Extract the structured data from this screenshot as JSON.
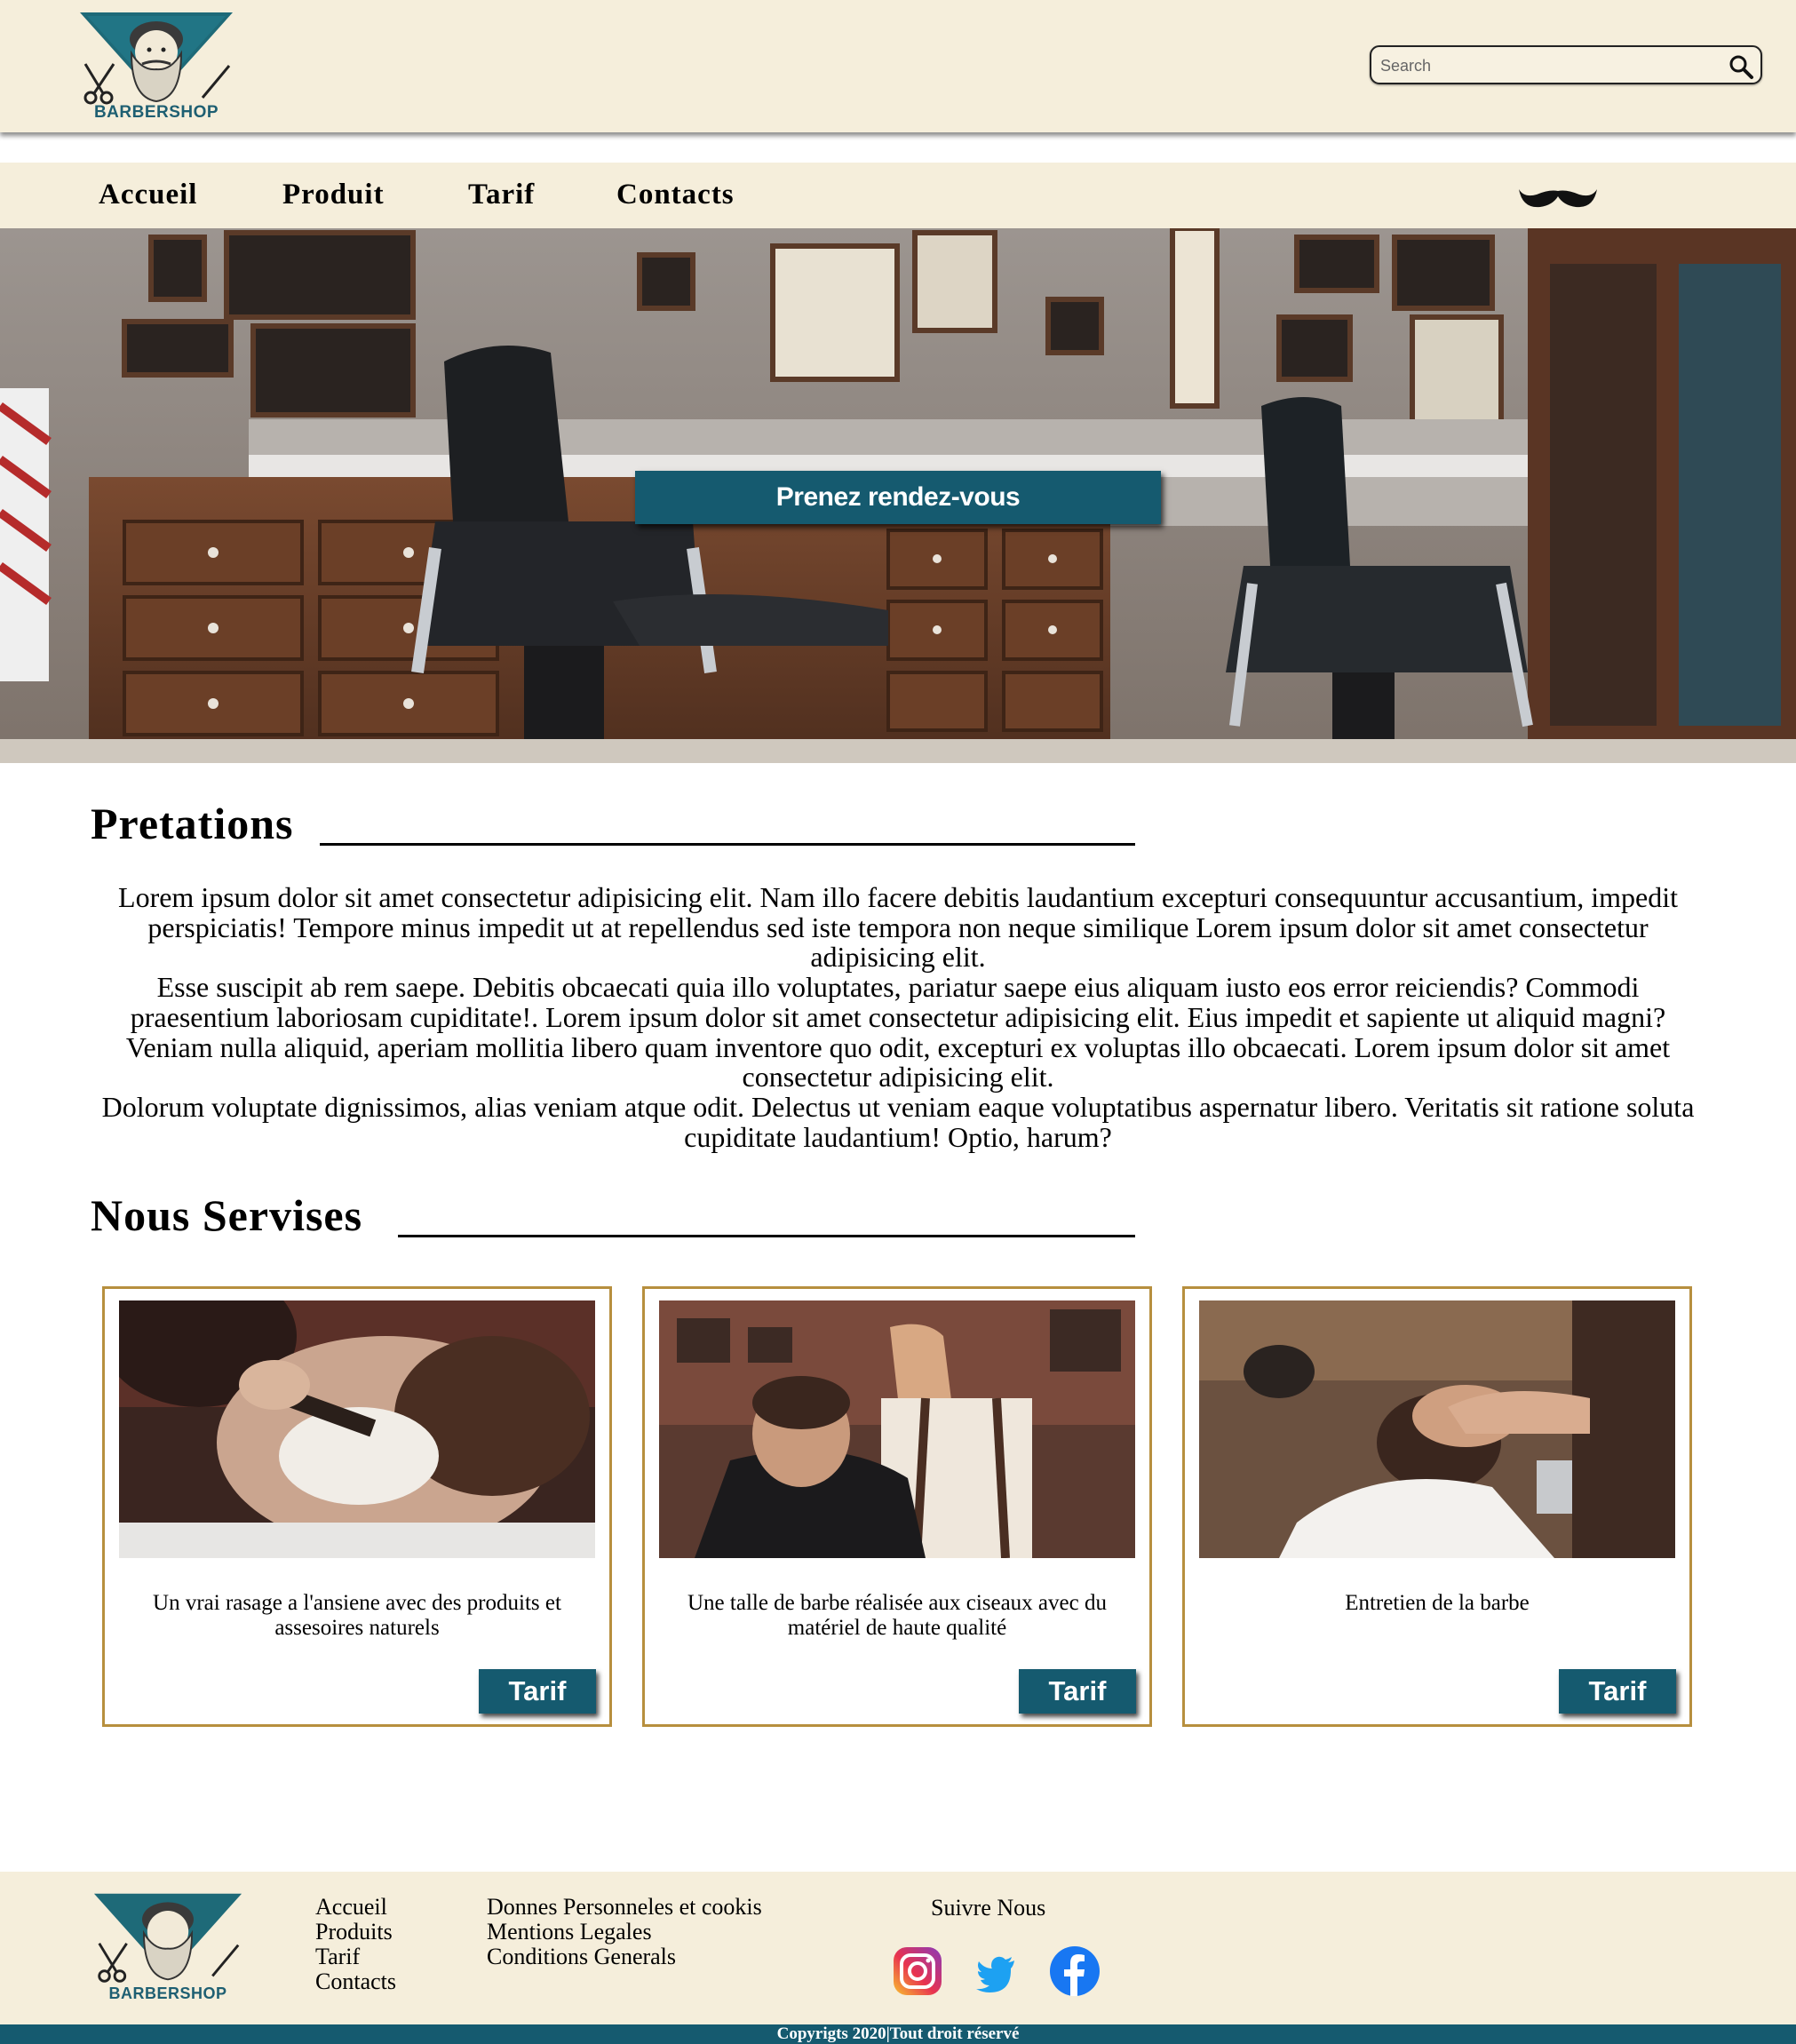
{
  "header": {
    "logo_text": "BARBERSHOP",
    "search_placeholder": "Search"
  },
  "nav": {
    "items": [
      {
        "label": "Accueil"
      },
      {
        "label": "Produit"
      },
      {
        "label": "Tarif"
      },
      {
        "label": "Contacts"
      }
    ]
  },
  "hero": {
    "button_label": "Prenez rendez-vous"
  },
  "sections": {
    "prestations_title": "Pretations",
    "prestations_paragraphs": [
      "Lorem ipsum dolor sit amet consectetur adipisicing elit. Nam illo facere debitis laudantium excepturi consequuntur accusantium, impedit perspiciatis! Tempore minus impedit ut at repellendus sed iste tempora non neque similique Lorem ipsum dolor sit amet consectetur adipisicing elit.",
      "Esse suscipit ab rem saepe. Debitis obcaecati quia illo voluptates, pariatur saepe eius aliquam iusto eos error reiciendis? Commodi praesentium laboriosam cupiditate!. Lorem ipsum dolor sit amet consectetur adipisicing elit. Eius impedit et sapiente ut aliquid magni? Veniam nulla aliquid, aperiam mollitia libero quam inventore quo odit, excepturi ex voluptas illo obcaecati. Lorem ipsum dolor sit amet consectetur adipisicing elit.",
      "Dolorum voluptate dignissimos, alias veniam atque odit. Delectus ut veniam eaque voluptatibus aspernatur libero. Veritatis sit ratione soluta cupiditate laudantium! Optio, harum?"
    ],
    "services_title": "Nous Servises"
  },
  "cards": [
    {
      "text": "Un vrai rasage a l'ansiene avec des produits et assesoires naturels",
      "button": "Tarif"
    },
    {
      "text": "Une talle de barbe réalisée aux ciseaux avec du matériel de haute qualité",
      "button": "Tarif"
    },
    {
      "text": "Entretien de la barbe",
      "button": "Tarif"
    }
  ],
  "footer": {
    "logo_text": "BARBERSHOP",
    "nav_links": [
      "Accueil",
      "Produits",
      "Tarif",
      "Contacts"
    ],
    "legal_links": [
      "Donnes Personneles et cookis",
      "Mentions Legales",
      "Conditions Generals"
    ],
    "follow_title": "Suivre Nous",
    "social_icons": [
      "instagram-icon",
      "twitter-icon",
      "facebook-icon"
    ],
    "copyright": "Copyrigts 2020|Tout droit réservé"
  },
  "colors": {
    "cream": "#f5eedb",
    "teal": "#155a6f",
    "gold_border": "#b78f3e"
  }
}
